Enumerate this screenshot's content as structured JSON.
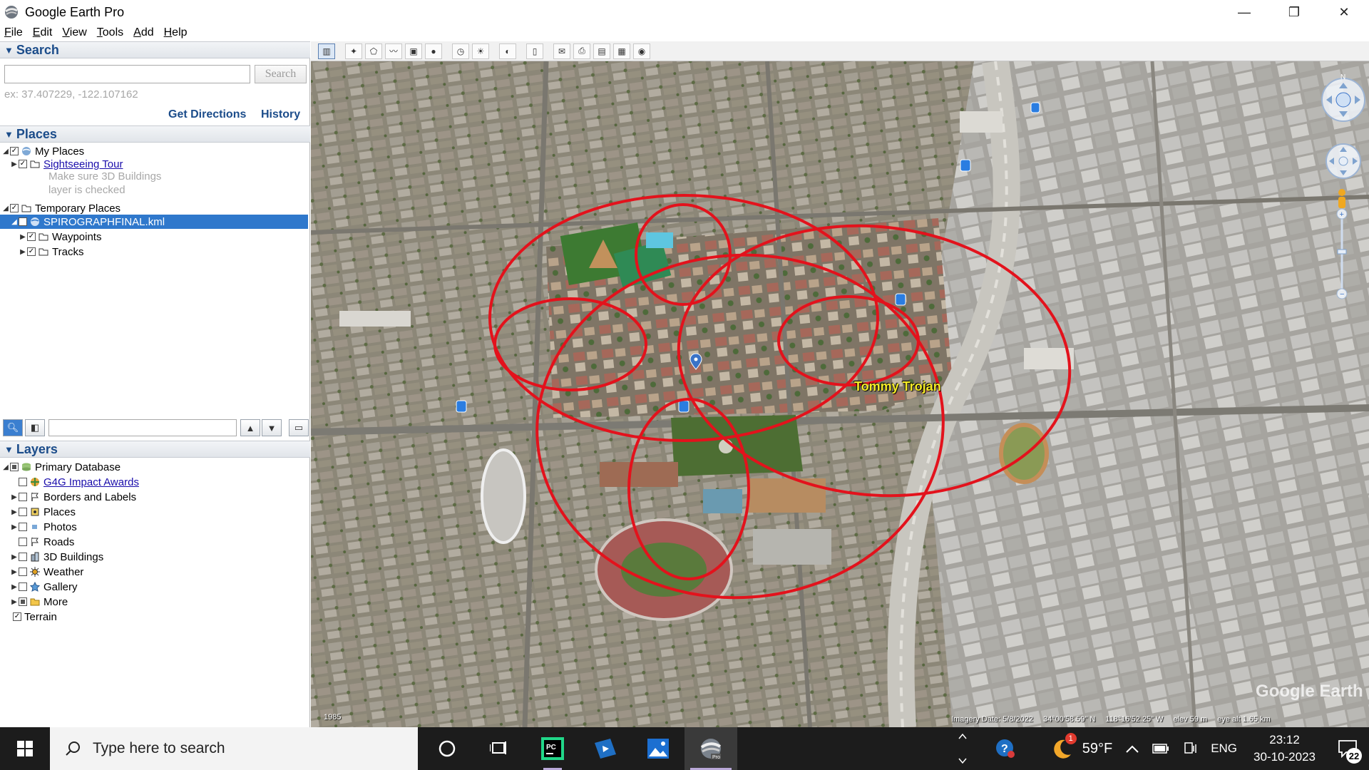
{
  "window": {
    "title": "Google Earth Pro",
    "minimize": "—",
    "restore": "❐",
    "close": "✕"
  },
  "menu": [
    "File",
    "Edit",
    "View",
    "Tools",
    "Add",
    "Help"
  ],
  "search": {
    "header": "Search",
    "placeholder": "",
    "button": "Search",
    "hint": "ex: 37.407229, -122.107162",
    "get_directions": "Get Directions",
    "history": "History"
  },
  "places": {
    "header": "Places",
    "my_places": "My Places",
    "sightseeing": "Sightseeing Tour",
    "sightseeing_desc_1": "Make sure 3D Buildings",
    "sightseeing_desc_2": "layer is checked",
    "temporary_places": "Temporary Places",
    "kml_file": "SPIROGRAPHFINAL.kml",
    "waypoints": "Waypoints",
    "tracks": "Tracks"
  },
  "layers": {
    "header": "Layers",
    "primary": "Primary Database",
    "items": [
      "G4G Impact Awards",
      "Borders and Labels",
      "Places",
      "Photos",
      "Roads",
      "3D Buildings",
      "Weather",
      "Gallery",
      "More"
    ],
    "terrain": "Terrain"
  },
  "map": {
    "placemark_label": "Tommy Trojan",
    "watermark": "Google Earth",
    "imagery_date": "Imagery Date: 5/8/2022",
    "lat": "34°00'58.59\" N",
    "lon": "118°16'52.25\" W",
    "elev": "elev   59 m",
    "eye_alt": "eye alt   1.65 km",
    "year": "1985",
    "north": "N"
  },
  "taskbar": {
    "search_placeholder": "Type here to search",
    "weather": "59°F",
    "weather_badge": "1",
    "language": "ENG",
    "time": "23:12",
    "date": "30-10-2023",
    "notifications": "22"
  }
}
